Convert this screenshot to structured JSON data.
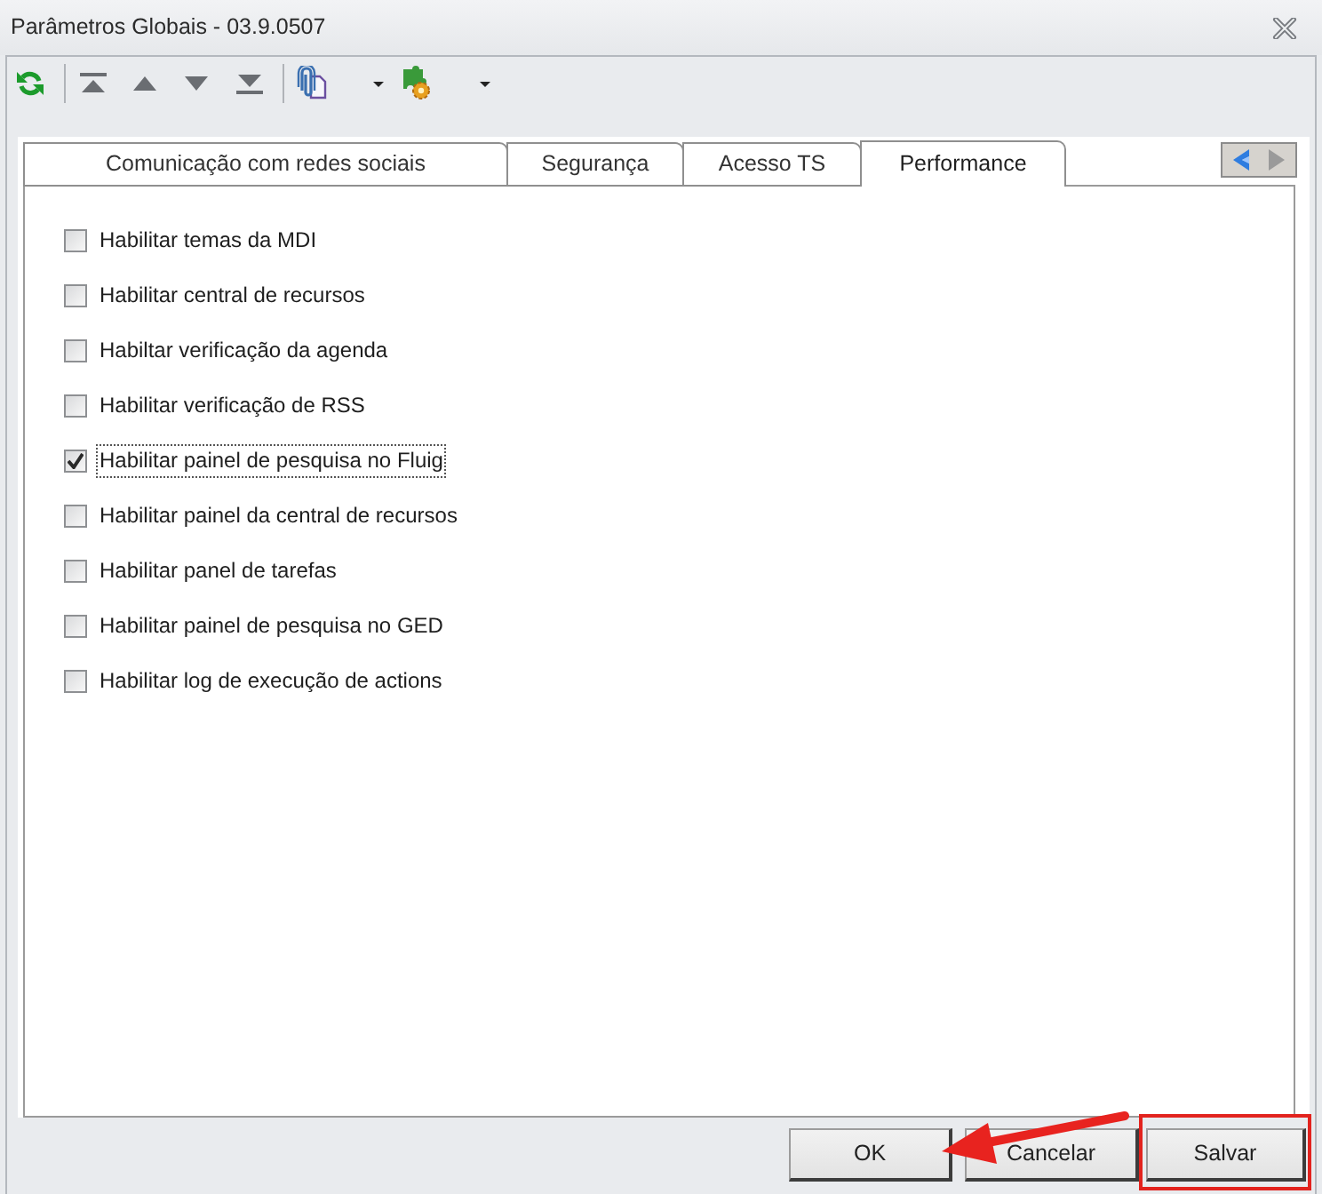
{
  "window": {
    "title": "Parâmetros Globais - 03.9.0507"
  },
  "tabs": [
    {
      "label": "Comunicação com redes sociais",
      "selected": false
    },
    {
      "label": "Segurança",
      "selected": false
    },
    {
      "label": "Acesso TS",
      "selected": false
    },
    {
      "label": "Performance",
      "selected": true
    }
  ],
  "options": [
    {
      "label": "Habilitar temas da MDI",
      "checked": false,
      "focused": false
    },
    {
      "label": "Habilitar central de recursos",
      "checked": false,
      "focused": false
    },
    {
      "label": "Habiltar verificação da agenda",
      "checked": false,
      "focused": false
    },
    {
      "label": "Habilitar verificação de RSS",
      "checked": false,
      "focused": false
    },
    {
      "label": "Habilitar painel de pesquisa no Fluig",
      "checked": true,
      "focused": true
    },
    {
      "label": "Habilitar painel da central de recursos",
      "checked": false,
      "focused": false
    },
    {
      "label": "Habilitar panel de tarefas",
      "checked": false,
      "focused": false
    },
    {
      "label": "Habilitar painel de pesquisa no GED",
      "checked": false,
      "focused": false
    },
    {
      "label": "Habilitar log de execução de actions",
      "checked": false,
      "focused": false
    }
  ],
  "buttons": [
    {
      "label": "OK",
      "pointed_at": true,
      "highlighted": false
    },
    {
      "label": "Cancelar",
      "pointed_at": false,
      "highlighted": false
    },
    {
      "label": "Salvar",
      "pointed_at": false,
      "highlighted": true
    }
  ]
}
